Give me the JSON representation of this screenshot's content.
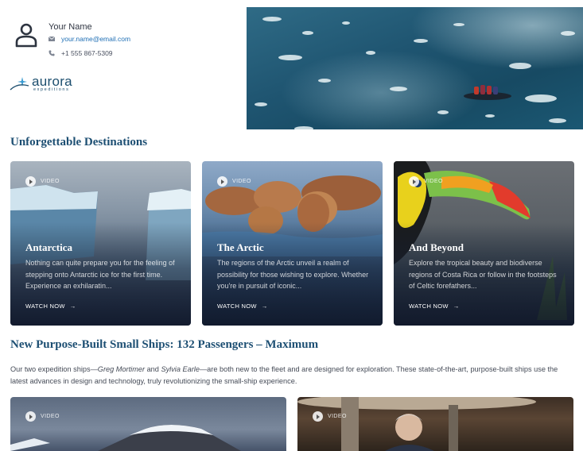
{
  "contact": {
    "name": "Your Name",
    "email": "your.name@email.com",
    "phone": "+1 555 867-5309"
  },
  "logo": {
    "word": "aurora",
    "sub": "expeditions"
  },
  "sections": {
    "destinations_title": "Unforgettable Destinations",
    "ships_title": "New Purpose-Built Small Ships: 132 Passengers – Maximum"
  },
  "cards": [
    {
      "badge": "VIDEO",
      "title": "Antarctica",
      "desc": "Nothing can quite prepare you for the feeling of stepping onto Antarctic ice for the first time. Experience an exhilaratin...",
      "cta": "WATCH NOW"
    },
    {
      "badge": "VIDEO",
      "title": "The Arctic",
      "desc": "The regions of the Arctic unveil a realm of possibility for those wishing to explore. Whether you're in pursuit of iconic...",
      "cta": "WATCH NOW"
    },
    {
      "badge": "VIDEO",
      "title": "And Beyond",
      "desc": "Explore the tropical beauty and biodiverse regions of Costa Rica or follow in the footsteps of Celtic forefathers...",
      "cta": "WATCH NOW"
    }
  ],
  "ships": {
    "intro": "Our two expedition ships—",
    "ship1": "Greg Mortimer",
    "and": " and ",
    "ship2": "Sylvia Earle",
    "rest": "—are both new to the fleet and are designed for exploration. These state-of-the-art, purpose-built ships use the latest advances in design and technology, truly revolutionizing the small-ship experience."
  },
  "bottom_cards": [
    {
      "badge": "VIDEO"
    },
    {
      "badge": "VIDEO"
    }
  ],
  "icons": {
    "avatar": "user-icon",
    "email": "envelope-icon",
    "phone": "phone-icon",
    "play": "play-icon",
    "arrow": "arrow-right-icon"
  },
  "colors": {
    "heading": "#1d4f73",
    "link": "#1f6fb5",
    "logo": "#1c4e6e"
  }
}
